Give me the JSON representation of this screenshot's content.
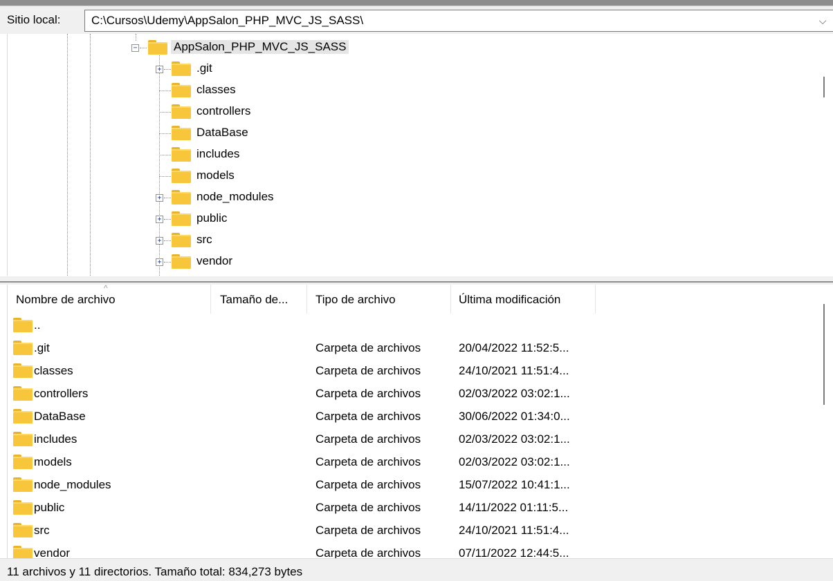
{
  "address": {
    "label": "Sitio local:",
    "path": "C:\\Cursos\\Udemy\\AppSalon_PHP_MVC_JS_SASS\\"
  },
  "tree": {
    "root": "AppSalon_PHP_MVC_JS_SASS",
    "children": [
      {
        "name": ".git",
        "expandable": true
      },
      {
        "name": "classes",
        "expandable": false
      },
      {
        "name": "controllers",
        "expandable": false
      },
      {
        "name": "DataBase",
        "expandable": false
      },
      {
        "name": "includes",
        "expandable": false
      },
      {
        "name": "models",
        "expandable": false
      },
      {
        "name": "node_modules",
        "expandable": true
      },
      {
        "name": "public",
        "expandable": true
      },
      {
        "name": "src",
        "expandable": true
      },
      {
        "name": "vendor",
        "expandable": true
      }
    ]
  },
  "file_list": {
    "columns": [
      "Nombre de archivo",
      "Tamaño de...",
      "Tipo de archivo",
      "Última modificación"
    ],
    "rows": [
      {
        "name": "..",
        "size": "",
        "type": "",
        "modified": ""
      },
      {
        "name": ".git",
        "size": "",
        "type": "Carpeta de archivos",
        "modified": "20/04/2022 11:52:5..."
      },
      {
        "name": "classes",
        "size": "",
        "type": "Carpeta de archivos",
        "modified": "24/10/2021 11:51:4..."
      },
      {
        "name": "controllers",
        "size": "",
        "type": "Carpeta de archivos",
        "modified": "02/03/2022 03:02:1..."
      },
      {
        "name": "DataBase",
        "size": "",
        "type": "Carpeta de archivos",
        "modified": "30/06/2022 01:34:0..."
      },
      {
        "name": "includes",
        "size": "",
        "type": "Carpeta de archivos",
        "modified": "02/03/2022 03:02:1..."
      },
      {
        "name": "models",
        "size": "",
        "type": "Carpeta de archivos",
        "modified": "02/03/2022 03:02:1..."
      },
      {
        "name": "node_modules",
        "size": "",
        "type": "Carpeta de archivos",
        "modified": "15/07/2022 10:41:1..."
      },
      {
        "name": "public",
        "size": "",
        "type": "Carpeta de archivos",
        "modified": "14/11/2022 01:11:5..."
      },
      {
        "name": "src",
        "size": "",
        "type": "Carpeta de archivos",
        "modified": "24/10/2021 11:51:4..."
      },
      {
        "name": "vendor",
        "size": "",
        "type": "Carpeta de archivos",
        "modified": "07/11/2022 12:44:5..."
      }
    ]
  },
  "status": {
    "text": "11 archivos y 11 directorios. Tamaño total: 834,273 bytes"
  },
  "colors": {
    "folder": "#f8c63a",
    "selection": "#e5e5e5",
    "chrome": "#f0f0f0"
  }
}
